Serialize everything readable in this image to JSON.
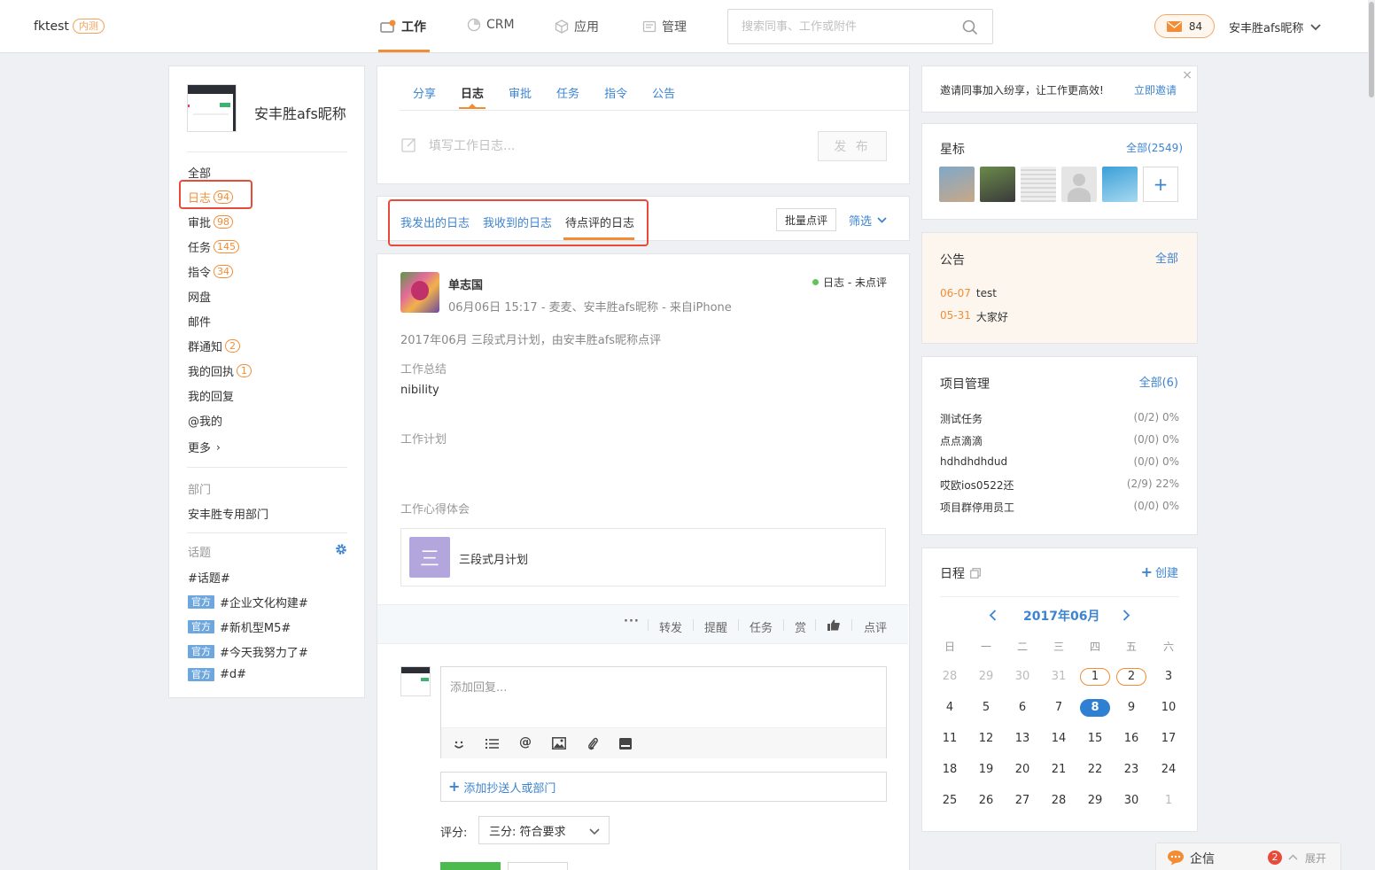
{
  "brand": {
    "name": "fktest",
    "tag": "内测"
  },
  "nav": [
    {
      "label": "工作",
      "icon": "work-icon"
    },
    {
      "label": "CRM",
      "icon": "crm-icon"
    },
    {
      "label": "应用",
      "icon": "apps-icon"
    },
    {
      "label": "管理",
      "icon": "manage-icon"
    }
  ],
  "search": {
    "placeholder": "搜索同事、工作或附件"
  },
  "mail": {
    "count": "84"
  },
  "user": {
    "name": "安丰胜afs昵称"
  },
  "profile": {
    "name": "安丰胜afs昵称"
  },
  "sidebar": {
    "items": [
      {
        "label": "全部",
        "count": ""
      },
      {
        "label": "日志",
        "count": "94"
      },
      {
        "label": "审批",
        "count": "98"
      },
      {
        "label": "任务",
        "count": "145"
      },
      {
        "label": "指令",
        "count": "34"
      },
      {
        "label": "网盘",
        "count": ""
      },
      {
        "label": "邮件",
        "count": ""
      },
      {
        "label": "群通知",
        "count": "2"
      },
      {
        "label": "我的回执",
        "count": "1"
      },
      {
        "label": "我的回复",
        "count": ""
      },
      {
        "label": "@我的",
        "count": ""
      }
    ],
    "more": "更多",
    "dept_label": "部门",
    "dept_name": "安丰胜专用部门",
    "topics_label": "话题",
    "topics": [
      {
        "official": "",
        "text": "#话题#"
      },
      {
        "official": "官方",
        "text": "#企业文化构建#"
      },
      {
        "official": "官方",
        "text": "#新机型M5#"
      },
      {
        "official": "官方",
        "text": "#今天我努力了#"
      },
      {
        "official": "官方",
        "text": "#d#"
      }
    ]
  },
  "compose": {
    "tabs": [
      "分享",
      "日志",
      "审批",
      "任务",
      "指令",
      "公告"
    ],
    "placeholder": "填写工作日志...",
    "publish": "发 布"
  },
  "filter": {
    "tabs": [
      "我发出的日志",
      "我收到的日志",
      "待点评的日志"
    ],
    "batch": "批量点评",
    "filter": "筛选"
  },
  "post": {
    "author": "单志国",
    "status": "日志 - 未点评",
    "meta": "06月06日 15:17 - 麦麦、安丰胜afs昵称 - 来自iPhone",
    "plan_line": "2017年06月 三段式月计划，由安丰胜afs昵称点评",
    "summary_label": "工作总结",
    "summary": "nibility",
    "plan_label": "工作计划",
    "insight_label": "工作心得体会",
    "attachment": {
      "icon_char": "三",
      "title": "三段式月计划"
    },
    "actions": [
      "转发",
      "提醒",
      "任务",
      "赏",
      "点评"
    ]
  },
  "reply": {
    "placeholder": "添加回复...",
    "cc": "添加抄送人或部门",
    "score_label": "评分:",
    "score_value": "三分: 符合要求"
  },
  "invite": {
    "text": "邀请同事加入纷享，让工作更高效!",
    "link": "立即邀请"
  },
  "star": {
    "title": "星标",
    "all": "全部(2549)"
  },
  "notice": {
    "title": "公告",
    "all": "全部",
    "items": [
      {
        "date": "06-07",
        "text": "test"
      },
      {
        "date": "05-31",
        "text": "大家好"
      }
    ]
  },
  "projects": {
    "title": "项目管理",
    "all": "全部(6)",
    "items": [
      {
        "name": "测试任务",
        "value": "(0/2) 0%"
      },
      {
        "name": "点点滴滴",
        "value": "(0/0) 0%"
      },
      {
        "name": "hdhdhdhdud",
        "value": "(0/0) 0%"
      },
      {
        "name": "哎欧ios0522还",
        "value": "(2/9) 22%"
      },
      {
        "name": "项目群停用员工",
        "value": "(0/0) 0%"
      }
    ]
  },
  "calendar": {
    "title": "日程",
    "create": "创建",
    "month": "2017年06月",
    "weekdays": [
      "日",
      "一",
      "二",
      "三",
      "四",
      "五",
      "六"
    ],
    "weeks": [
      [
        "28",
        "29",
        "30",
        "31",
        "1",
        "2",
        "3"
      ],
      [
        "4",
        "5",
        "6",
        "7",
        "8",
        "9",
        "10"
      ],
      [
        "11",
        "12",
        "13",
        "14",
        "15",
        "16",
        "17"
      ],
      [
        "18",
        "19",
        "20",
        "21",
        "22",
        "23",
        "24"
      ],
      [
        "25",
        "26",
        "27",
        "28",
        "29",
        "30",
        "1"
      ]
    ],
    "dim": [
      [
        0,
        0
      ],
      [
        0,
        1
      ],
      [
        0,
        2
      ],
      [
        0,
        3
      ],
      [
        4,
        6
      ]
    ],
    "ring": [
      [
        0,
        4
      ],
      [
        0,
        5
      ]
    ],
    "today": [
      1,
      4
    ]
  },
  "chat": {
    "label": "企信",
    "badge": "2",
    "expand": "展开"
  },
  "colors": {
    "accent": "#f28d35",
    "link": "#3d84d0",
    "highlight": "#e84b3a",
    "today": "#2f7fd3"
  }
}
